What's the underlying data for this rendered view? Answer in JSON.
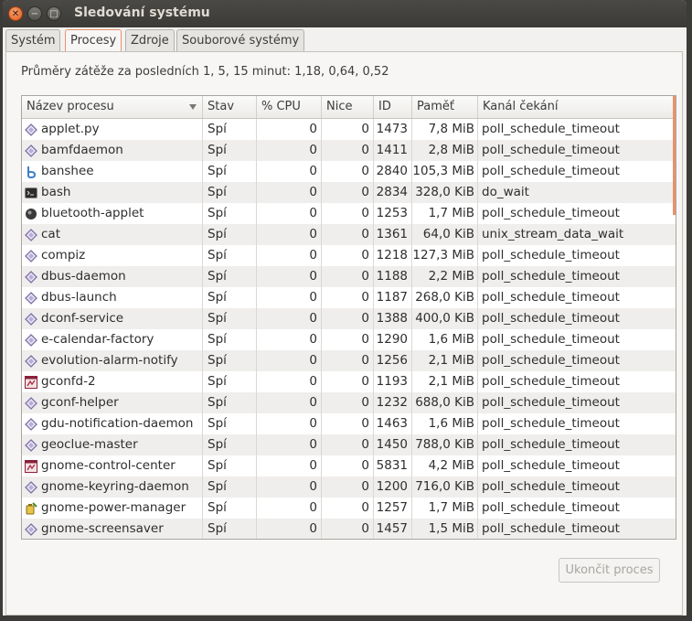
{
  "window": {
    "title": "Sledování systému"
  },
  "tabs": [
    {
      "label": "Systém"
    },
    {
      "label": "Procesy"
    },
    {
      "label": "Zdroje"
    },
    {
      "label": "Souborové systémy"
    }
  ],
  "load_average": "Průměry zátěže za posledních 1, 5, 15 minut: 1,18, 0,64, 0,52",
  "columns": {
    "name": "Název procesu",
    "state": "Stav",
    "cpu": "% CPU",
    "nice": "Nice",
    "id": "ID",
    "memory": "Paměť",
    "wait": "Kanál čekání"
  },
  "processes": [
    {
      "icon": "generic-process-icon",
      "name": "applet.py",
      "state": "Spí",
      "cpu": "0",
      "nice": "0",
      "id": "1473",
      "memory": "7,8 MiB",
      "wait": "poll_schedule_timeout"
    },
    {
      "icon": "generic-process-icon",
      "name": "bamfdaemon",
      "state": "Spí",
      "cpu": "0",
      "nice": "0",
      "id": "1411",
      "memory": "2,8 MiB",
      "wait": "poll_schedule_timeout"
    },
    {
      "icon": "banshee-icon",
      "name": "banshee",
      "state": "Spí",
      "cpu": "0",
      "nice": "0",
      "id": "2840",
      "memory": "105,3 MiB",
      "wait": "poll_schedule_timeout"
    },
    {
      "icon": "terminal-icon",
      "name": "bash",
      "state": "Spí",
      "cpu": "0",
      "nice": "0",
      "id": "2834",
      "memory": "328,0 KiB",
      "wait": "do_wait"
    },
    {
      "icon": "bluetooth-icon",
      "name": "bluetooth-applet",
      "state": "Spí",
      "cpu": "0",
      "nice": "0",
      "id": "1253",
      "memory": "1,7 MiB",
      "wait": "poll_schedule_timeout"
    },
    {
      "icon": "generic-process-icon",
      "name": "cat",
      "state": "Spí",
      "cpu": "0",
      "nice": "0",
      "id": "1361",
      "memory": "64,0 KiB",
      "wait": "unix_stream_data_wait"
    },
    {
      "icon": "generic-process-icon",
      "name": "compiz",
      "state": "Spí",
      "cpu": "0",
      "nice": "0",
      "id": "1218",
      "memory": "127,3 MiB",
      "wait": "poll_schedule_timeout"
    },
    {
      "icon": "generic-process-icon",
      "name": "dbus-daemon",
      "state": "Spí",
      "cpu": "0",
      "nice": "0",
      "id": "1188",
      "memory": "2,2 MiB",
      "wait": "poll_schedule_timeout"
    },
    {
      "icon": "generic-process-icon",
      "name": "dbus-launch",
      "state": "Spí",
      "cpu": "0",
      "nice": "0",
      "id": "1187",
      "memory": "268,0 KiB",
      "wait": "poll_schedule_timeout"
    },
    {
      "icon": "generic-process-icon",
      "name": "dconf-service",
      "state": "Spí",
      "cpu": "0",
      "nice": "0",
      "id": "1388",
      "memory": "400,0 KiB",
      "wait": "poll_schedule_timeout"
    },
    {
      "icon": "generic-process-icon",
      "name": "e-calendar-factory",
      "state": "Spí",
      "cpu": "0",
      "nice": "0",
      "id": "1290",
      "memory": "1,6 MiB",
      "wait": "poll_schedule_timeout"
    },
    {
      "icon": "generic-process-icon",
      "name": "evolution-alarm-notify",
      "state": "Spí",
      "cpu": "0",
      "nice": "0",
      "id": "1256",
      "memory": "2,1 MiB",
      "wait": "poll_schedule_timeout"
    },
    {
      "icon": "gconf-icon",
      "name": "gconfd-2",
      "state": "Spí",
      "cpu": "0",
      "nice": "0",
      "id": "1193",
      "memory": "2,1 MiB",
      "wait": "poll_schedule_timeout"
    },
    {
      "icon": "generic-process-icon",
      "name": "gconf-helper",
      "state": "Spí",
      "cpu": "0",
      "nice": "0",
      "id": "1232",
      "memory": "688,0 KiB",
      "wait": "poll_schedule_timeout"
    },
    {
      "icon": "generic-process-icon",
      "name": "gdu-notification-daemon",
      "state": "Spí",
      "cpu": "0",
      "nice": "0",
      "id": "1463",
      "memory": "1,6 MiB",
      "wait": "poll_schedule_timeout"
    },
    {
      "icon": "generic-process-icon",
      "name": "geoclue-master",
      "state": "Spí",
      "cpu": "0",
      "nice": "0",
      "id": "1450",
      "memory": "788,0 KiB",
      "wait": "poll_schedule_timeout"
    },
    {
      "icon": "gconf-icon",
      "name": "gnome-control-center",
      "state": "Spí",
      "cpu": "0",
      "nice": "0",
      "id": "5831",
      "memory": "4,2 MiB",
      "wait": "poll_schedule_timeout"
    },
    {
      "icon": "generic-process-icon",
      "name": "gnome-keyring-daemon",
      "state": "Spí",
      "cpu": "0",
      "nice": "0",
      "id": "1200",
      "memory": "716,0 KiB",
      "wait": "poll_schedule_timeout"
    },
    {
      "icon": "power-icon",
      "name": "gnome-power-manager",
      "state": "Spí",
      "cpu": "0",
      "nice": "0",
      "id": "1257",
      "memory": "1,7 MiB",
      "wait": "poll_schedule_timeout"
    },
    {
      "icon": "generic-process-icon",
      "name": "gnome-screensaver",
      "state": "Spí",
      "cpu": "0",
      "nice": "0",
      "id": "1457",
      "memory": "1,5 MiB",
      "wait": "poll_schedule_timeout"
    }
  ],
  "end_process_button": "Ukončit proces",
  "colors": {
    "accent": "#e8936a",
    "close_button": "#e15a1b"
  }
}
